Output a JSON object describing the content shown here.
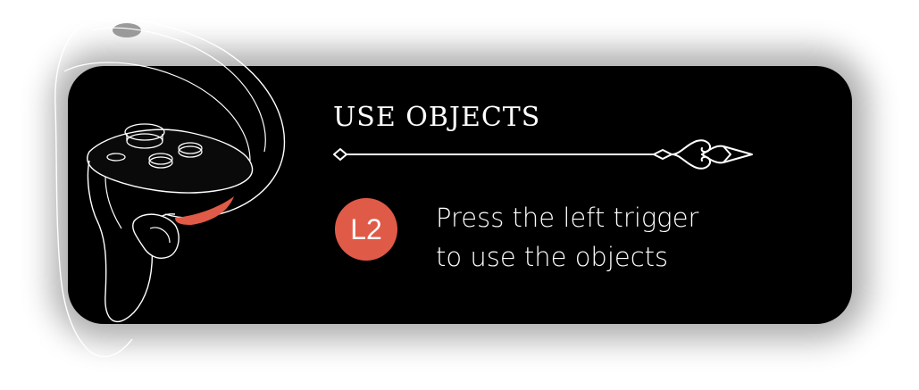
{
  "prompt": {
    "title": "USE OBJECTS",
    "button_label": "L2",
    "instruction_lines": [
      "Press the left trigger",
      "to use the objects"
    ]
  },
  "icons": {
    "controller": "vr-left-controller-icon",
    "divider": "ornamental-divider-icon"
  },
  "colors": {
    "card_background": "#000000",
    "accent": "#e05a48",
    "text": "#ffffff"
  }
}
